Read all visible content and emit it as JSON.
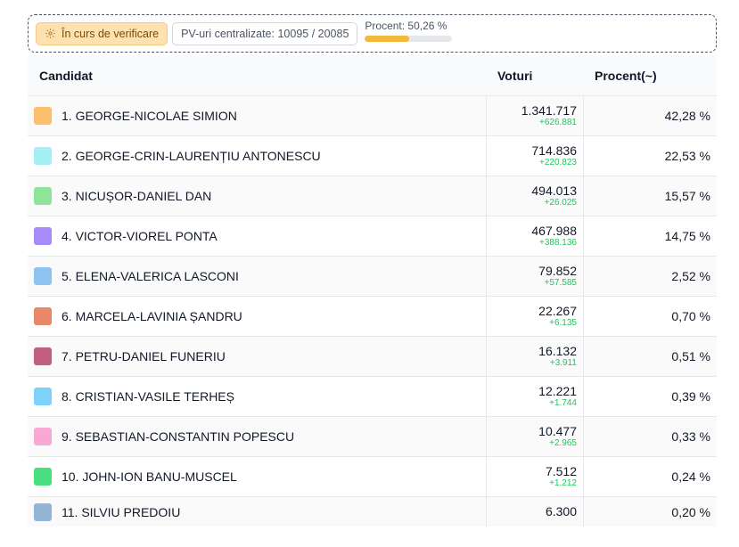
{
  "status": {
    "verify_label": "În curs de verificare",
    "pv_label": "PV-uri centralizate: 10095 / 20085",
    "progress_label": "Procent: 50,26 %",
    "progress_value": 0.5026
  },
  "table": {
    "headers": {
      "candidate": "Candidat",
      "votes": "Voturi",
      "percent": "Procent(~)"
    },
    "rows": [
      {
        "name": "1. GEORGE-NICOLAE SIMION",
        "votes": "1.341.717",
        "delta": "+626.881",
        "percent": "42,28 %",
        "color": "#fbbf6e"
      },
      {
        "name": "2. GEORGE-CRIN-LAURENȚIU ANTONESCU",
        "votes": "714.836",
        "delta": "+220.823",
        "percent": "22,53 %",
        "color": "#a5f0f6"
      },
      {
        "name": "3. NICUȘOR-DANIEL DAN",
        "votes": "494.013",
        "delta": "+26.025",
        "percent": "15,57 %",
        "color": "#8fe39b"
      },
      {
        "name": "4. VICTOR-VIOREL PONTA",
        "votes": "467.988",
        "delta": "+388.136",
        "percent": "14,75 %",
        "color": "#a78bfa"
      },
      {
        "name": "5. ELENA-VALERICA LASCONI",
        "votes": "79.852",
        "delta": "+57.585",
        "percent": "2,52 %",
        "color": "#8ec3f2"
      },
      {
        "name": "6. MARCELA-LAVINIA ȘANDRU",
        "votes": "22.267",
        "delta": "+6.135",
        "percent": "0,70 %",
        "color": "#e9876a"
      },
      {
        "name": "7. PETRU-DANIEL FUNERIU",
        "votes": "16.132",
        "delta": "+3.911",
        "percent": "0,51 %",
        "color": "#c05f82"
      },
      {
        "name": "8. CRISTIAN-VASILE TERHEȘ",
        "votes": "12.221",
        "delta": "+1.744",
        "percent": "0,39 %",
        "color": "#7dd3fc"
      },
      {
        "name": "9. SEBASTIAN-CONSTANTIN POPESCU",
        "votes": "10.477",
        "delta": "+2.965",
        "percent": "0,33 %",
        "color": "#f9a8d4"
      },
      {
        "name": "10. JOHN-ION BANU-MUSCEL",
        "votes": "7.512",
        "delta": "+1.212",
        "percent": "0,24 %",
        "color": "#4ade80"
      },
      {
        "name": "11. SILVIU PREDOIU",
        "votes": "6.300",
        "delta": "",
        "percent": "0,20 %",
        "color": "#93b4d6"
      }
    ]
  }
}
